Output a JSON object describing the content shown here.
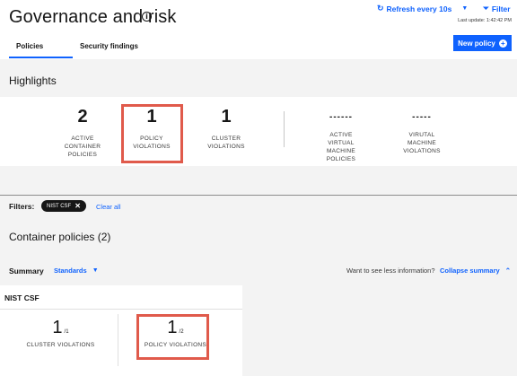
{
  "header": {
    "title": "Governance and risk",
    "refresh_label": "Refresh every 10s",
    "filter_label": "Filter",
    "last_update": "Last update: 1:42:42 PM",
    "tabs": [
      {
        "label": "Policies"
      },
      {
        "label": "Security findings"
      }
    ],
    "new_policy_label": "New policy"
  },
  "highlights": {
    "title": "Highlights",
    "items": [
      {
        "value": "2",
        "label_lines": [
          "ACTIVE",
          "CONTAINER",
          "POLICIES"
        ]
      },
      {
        "value": "1",
        "label_lines": [
          "POLICY",
          "VIOLATIONS"
        ]
      },
      {
        "value": "1",
        "label_lines": [
          "CLUSTER",
          "VIOLATIONS"
        ]
      },
      {
        "value": "------",
        "label_lines": [
          "ACTIVE",
          "VIRTUAL",
          "MACHINE",
          "POLICIES"
        ]
      },
      {
        "value": "-----",
        "label_lines": [
          "VIRUTAL",
          "MACHINE",
          "VIOLATIONS"
        ]
      }
    ]
  },
  "filters": {
    "label": "Filters:",
    "chips": [
      {
        "label": "NIST CSF"
      }
    ],
    "clear_all": "Clear all"
  },
  "container_policies": {
    "title": "Container policies (2)",
    "summary_label": "Summary",
    "standards_label": "Standards",
    "want_less": "Want to see less information?",
    "collapse_label": "Collapse summary",
    "card": {
      "title": "NIST CSF",
      "stats": [
        {
          "value": "1",
          "total": "/1",
          "label": "CLUSTER VIOLATIONS"
        },
        {
          "value": "1",
          "total": "/2",
          "label": "POLICY VIOLATIONS"
        }
      ]
    }
  },
  "colors": {
    "accent": "#0f62fe",
    "highlight_box": "#e05a4b",
    "background": "#f3f3f3"
  }
}
